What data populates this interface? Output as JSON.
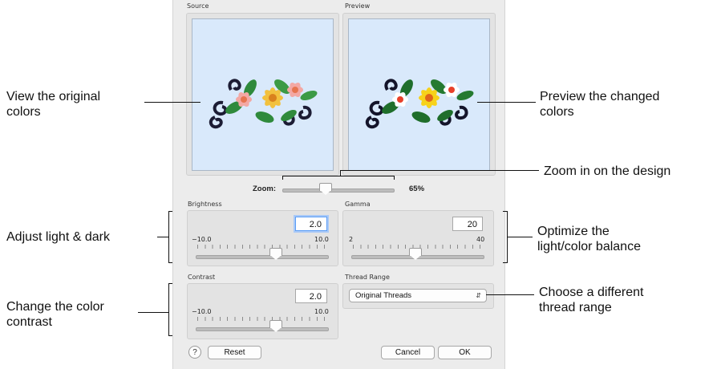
{
  "source": {
    "title": "Source"
  },
  "preview": {
    "title": "Preview"
  },
  "zoom": {
    "label": "Zoom:",
    "value": "65%",
    "level_percent": 65
  },
  "brightness": {
    "title": "Brightness",
    "value": "2.0",
    "min": "−10.0",
    "max": "10.0",
    "level": 2.0
  },
  "gamma": {
    "title": "Gamma",
    "value": "20",
    "min": "2",
    "max": "40",
    "level": 20
  },
  "contrast": {
    "title": "Contrast",
    "value": "2.0",
    "min": "−10.0",
    "max": "10.0",
    "level": 2.0
  },
  "thread_range": {
    "title": "Thread Range",
    "selected": "Original Threads"
  },
  "buttons": {
    "help": "?",
    "reset": "Reset",
    "cancel": "Cancel",
    "ok": "OK"
  },
  "callouts": {
    "view_original_1": "View the original",
    "view_original_2": "colors",
    "preview_changed_1": "Preview the changed",
    "preview_changed_2": "colors",
    "zoom_in": "Zoom in on the design",
    "adjust_light": "Adjust light & dark",
    "optimize_1": "Optimize the",
    "optimize_2": "light/color balance",
    "change_contrast_1": "Change the color",
    "change_contrast_2": "contrast",
    "choose_thread_1": "Choose a different",
    "choose_thread_2": "thread range"
  },
  "colors": {
    "canvas_bg": "#d9e9fb",
    "focus_ring": "#5b9df5",
    "dialog_bg": "#ececec"
  },
  "icons": [
    "embroidery-design-image",
    "chevron-updown-icon",
    "help-icon"
  ]
}
